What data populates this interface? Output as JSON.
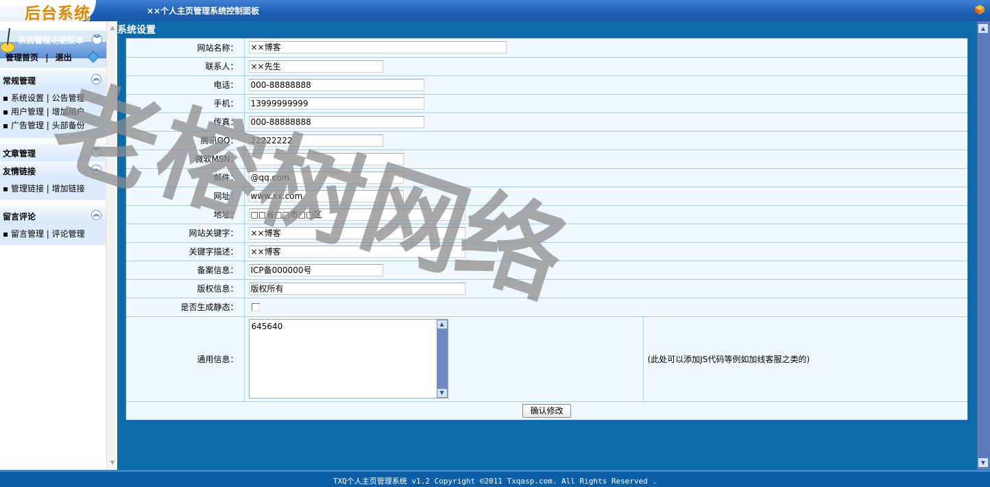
{
  "header": {
    "logo": "后台系统",
    "title": "××个人主页管理系统控制面板"
  },
  "sidebar": {
    "menu_title": "系统管理功能菜单",
    "home_link": "管理首页",
    "separator": "|",
    "logout_link": "退出",
    "sections": [
      {
        "title": "常规管理",
        "items": [
          "▪ 系统设置 | 公告管理",
          "▪ 用户管理 | 增加用户",
          "▪ 广告管理 | 头部备份"
        ]
      },
      {
        "title": "文章管理",
        "items": []
      },
      {
        "title": "友情链接",
        "items": [
          "▪ 管理链接 | 增加链接"
        ]
      },
      {
        "title": "留言评论",
        "items": [
          "▪ 留言管理 | 评论管理"
        ]
      }
    ]
  },
  "main": {
    "title": "系统设置",
    "fields": [
      {
        "label": "网站名称：",
        "value": "××博客"
      },
      {
        "label": "联系人：",
        "value": "××先生"
      },
      {
        "label": "电话：",
        "value": "000-88888888"
      },
      {
        "label": "手机：",
        "value": "13999999999"
      },
      {
        "label": "传真：",
        "value": "000-88888888"
      },
      {
        "label": "腾讯QQ：",
        "value": "22222222"
      },
      {
        "label": "微软MSN：",
        "value": ""
      },
      {
        "label": "邮件：",
        "value": "@qq.com"
      },
      {
        "label": "网址：",
        "value": "www.xx.com"
      },
      {
        "label": "地址：",
        "value": "□□省□□市□□区"
      },
      {
        "label": "网站关键字：",
        "value": "××博客"
      },
      {
        "label": "关键字描述：",
        "value": "××博客"
      },
      {
        "label": "备案信息：",
        "value": "ICP备000000号"
      },
      {
        "label": "版权信息：",
        "value": "版权所有"
      }
    ],
    "static_label": "是否生成静态：",
    "common_label": "通用信息：",
    "common_value": "645640",
    "common_note": "(此处可以添加JS代码等例如加线客服之类的)",
    "submit_label": "确认修改"
  },
  "footer": {
    "text": "TXQ个人主页管理系统 v1.2    Copyright ©2011 Txqasp.com. All Rights Reserved ."
  },
  "watermark": "老榕树网络"
}
